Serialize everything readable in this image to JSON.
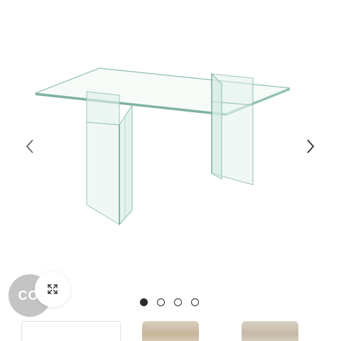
{
  "gallery": {
    "product_image_name": "glass-dining-table",
    "badge_text": "CO",
    "badge_color": "#c4c4c4",
    "prev_icon": "chevron-left-icon",
    "next_icon": "chevron-right-icon",
    "expand_icon": "expand-icon",
    "current_slide": 1,
    "total_slides": 4,
    "dot_color": "#2b2b2b",
    "thumbnails": [
      {
        "name": "thumbnail-1"
      },
      {
        "name": "thumbnail-2"
      },
      {
        "name": "thumbnail-3"
      }
    ]
  }
}
